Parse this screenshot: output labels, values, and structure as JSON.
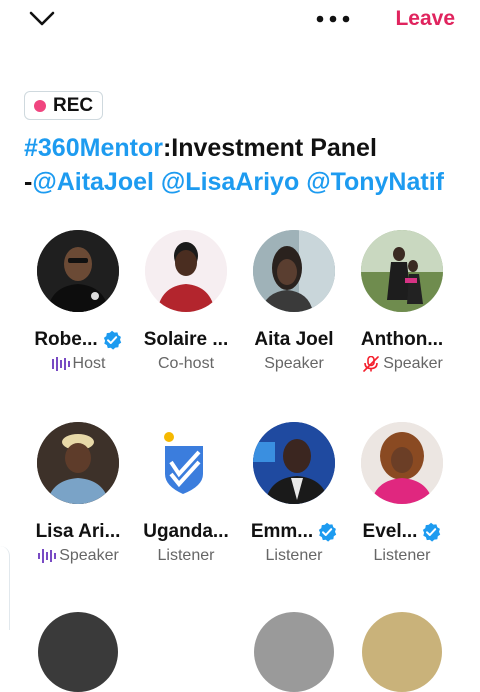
{
  "header": {
    "leave_label": "Leave"
  },
  "recording": {
    "label": "REC"
  },
  "space": {
    "hashtag": "#360Mentor",
    "title_rest": ":Investment Panel",
    "dash": "-",
    "mention1": "@AitaJoel",
    "mention2": "@LisaAriyo",
    "mention3": "@TonyNatif"
  },
  "participants": [
    {
      "name": "Robe...",
      "role": "Host",
      "verified": true,
      "role_icon": "speaking-wave-icon"
    },
    {
      "name": "Solaire ...",
      "role": "Co-host",
      "verified": false,
      "role_icon": ""
    },
    {
      "name": "Aita Joel",
      "role": "Speaker",
      "verified": false,
      "role_icon": ""
    },
    {
      "name": "Anthon...",
      "role": "Speaker",
      "verified": false,
      "role_icon": "mic-muted-icon"
    },
    {
      "name": "Lisa Ari...",
      "role": "Speaker",
      "verified": false,
      "role_icon": "speaking-wave-icon"
    },
    {
      "name": "Uganda...",
      "role": "Listener",
      "verified": false,
      "role_icon": ""
    },
    {
      "name": "Emm...",
      "role": "Listener",
      "verified": true,
      "role_icon": ""
    },
    {
      "name": "Evel...",
      "role": "Listener",
      "verified": true,
      "role_icon": ""
    }
  ],
  "colors": {
    "accent": "#1d9bf0",
    "leave": "#e0245e",
    "rec_dot": "#f0457f",
    "speaking": "#794bc4"
  }
}
